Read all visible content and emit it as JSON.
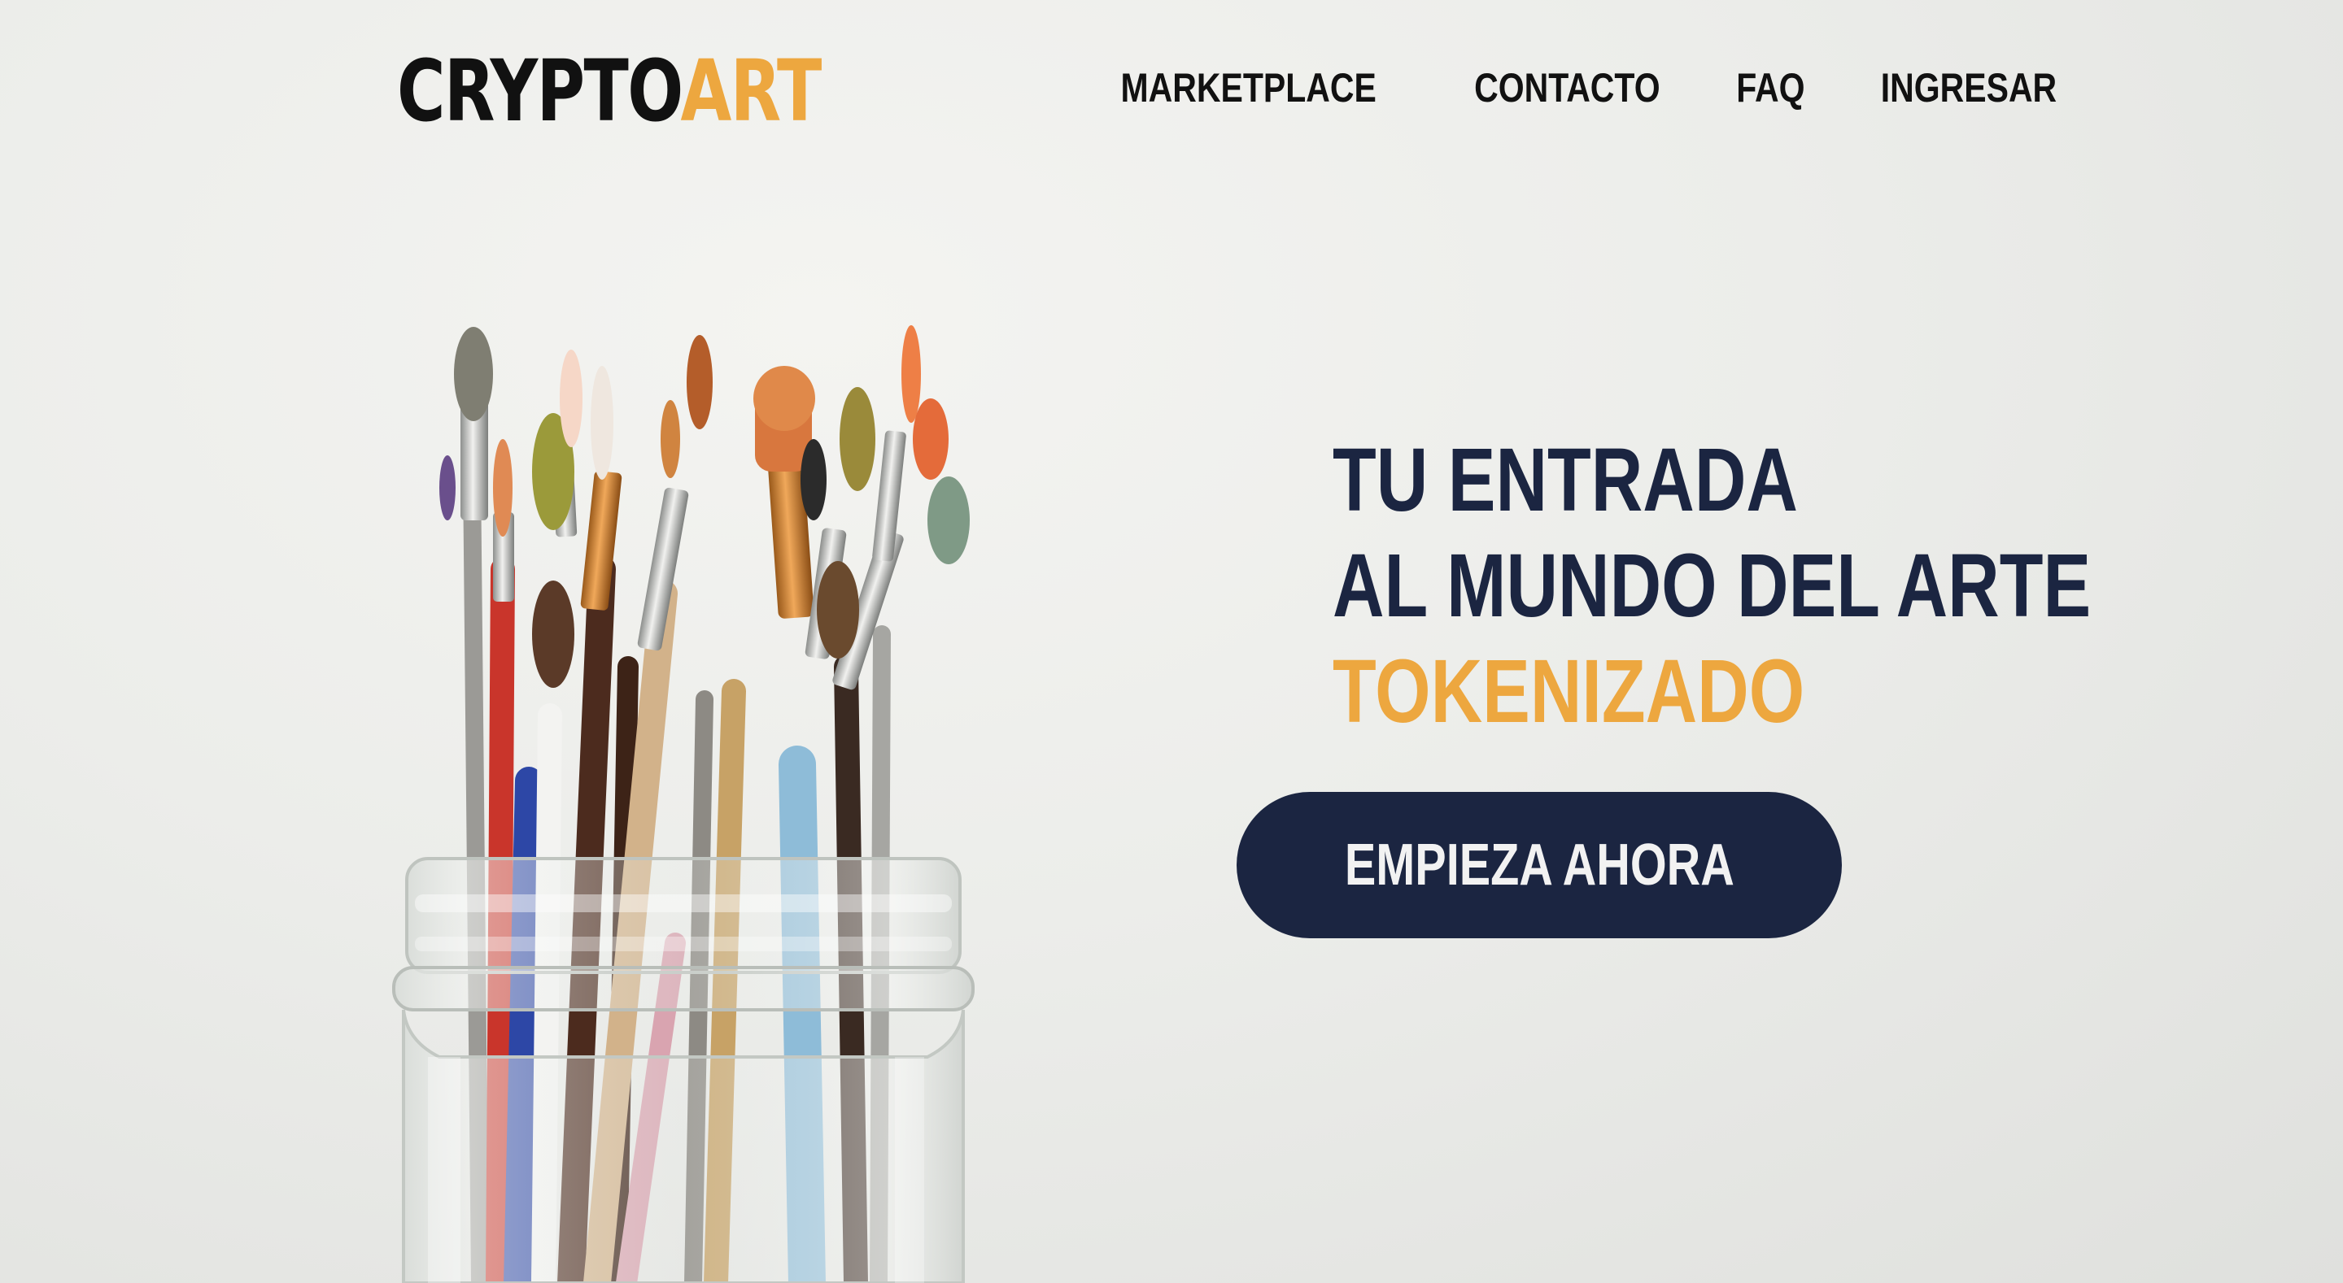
{
  "brand": {
    "logo_part1": "CRYPTO",
    "logo_part2": "ART",
    "accent_color": "#eda73f",
    "dark_color": "#1b2541"
  },
  "nav": {
    "items": [
      {
        "label": "MARKETPLACE"
      },
      {
        "label": "CONTACTO"
      },
      {
        "label": "FAQ"
      },
      {
        "label": "INGRESAR"
      }
    ]
  },
  "hero": {
    "line1": "TU ENTRADA",
    "line2": "AL MUNDO DEL ARTE",
    "line3": "TOKENIZADO",
    "cta_label": "EMPIEZA AHORA"
  },
  "illustration": {
    "icon": "paintbrush-jar-photo"
  }
}
